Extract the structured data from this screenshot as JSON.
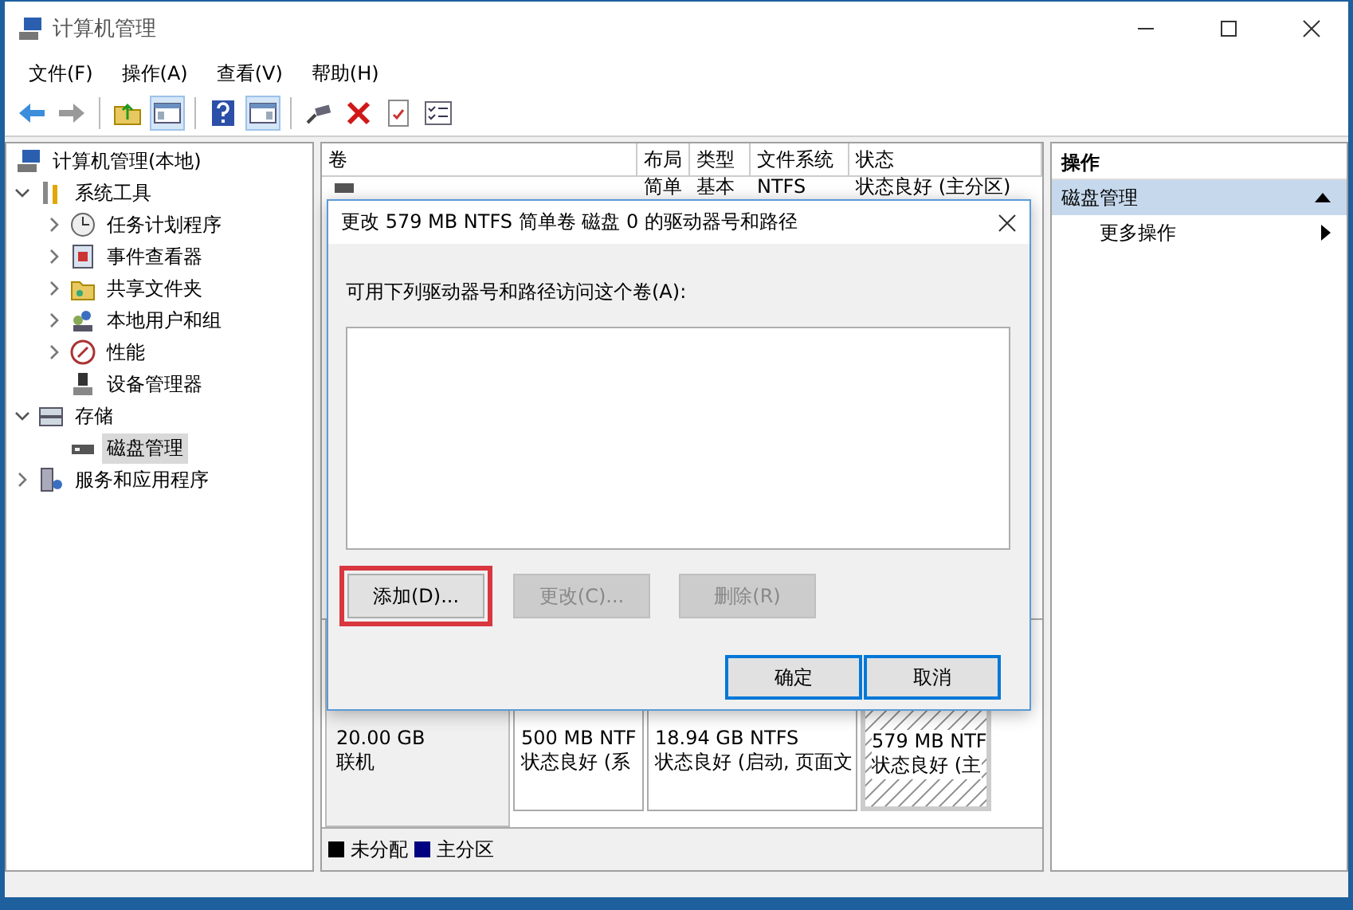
{
  "window": {
    "title": "计算机管理"
  },
  "menu": [
    "文件(F)",
    "操作(A)",
    "查看(V)",
    "帮助(H)"
  ],
  "toolbar": [
    {
      "kind": "back",
      "disabled": false
    },
    {
      "kind": "forward",
      "disabled": true
    },
    {
      "kind": "separator"
    },
    {
      "kind": "folder_up",
      "disabled": false
    },
    {
      "kind": "tree_toggle",
      "on": true
    },
    {
      "kind": "separator"
    },
    {
      "kind": "help",
      "disabled": false
    },
    {
      "kind": "pane_toggle",
      "on": true
    },
    {
      "kind": "separator"
    },
    {
      "kind": "connect"
    },
    {
      "kind": "delete",
      "disabled": false
    },
    {
      "kind": "properties"
    },
    {
      "kind": "checklist"
    }
  ],
  "tree": {
    "items": [
      {
        "label": "计算机管理(本地)",
        "kind": "computer",
        "selected": false,
        "children": [
          {
            "label": "系统工具",
            "kind": "tools",
            "expanded": true,
            "selected": false,
            "children": [
              {
                "label": "任务计划程序",
                "kind": "clock",
                "expanded": false,
                "selected": false
              },
              {
                "label": "事件查看器",
                "kind": "event",
                "expanded": false,
                "selected": false
              },
              {
                "label": "共享文件夹",
                "kind": "share",
                "expanded": false,
                "selected": false
              },
              {
                "label": "本地用户和组",
                "kind": "users",
                "expanded": false,
                "selected": false
              },
              {
                "label": "性能",
                "kind": "perf",
                "expanded": false,
                "selected": false
              },
              {
                "label": "设备管理器",
                "kind": "device",
                "selected": false
              }
            ]
          },
          {
            "label": "存储",
            "kind": "storage",
            "expanded": true,
            "selected": false,
            "children": [
              {
                "label": "磁盘管理",
                "kind": "disk",
                "selected": true
              }
            ]
          },
          {
            "label": "服务和应用程序",
            "kind": "services",
            "expanded": false,
            "selected": false
          }
        ]
      }
    ]
  },
  "volumes": {
    "columns": [
      "卷",
      "布局",
      "类型",
      "文件系统",
      "状态"
    ],
    "rows": [
      {
        "layout": "简单",
        "type": "基本",
        "file_system": "NTFS",
        "status": "状态良好 (主分区)"
      }
    ]
  },
  "disk_map": {
    "disk": {
      "size": "20.00 GB",
      "status": "联机"
    },
    "partitions": [
      {
        "size": "500 MB NTF",
        "status": "状态良好 (系",
        "selected": false
      },
      {
        "size": "18.94 GB NTFS",
        "status": "状态良好 (启动, 页面文",
        "selected": false
      },
      {
        "size": "579 MB NTF",
        "status": "状态良好 (主",
        "selected": true
      }
    ],
    "legend": [
      {
        "label": "未分配",
        "color": "#000000"
      },
      {
        "label": "主分区",
        "color": "#000080"
      }
    ]
  },
  "actions": {
    "header": "操作",
    "items": [
      {
        "label": "磁盘管理",
        "kind": "section",
        "selected": true
      },
      {
        "label": "更多操作",
        "kind": "submenu",
        "selected": false
      }
    ]
  },
  "dialog": {
    "title": "更改 579 MB NTFS 简单卷 磁盘 0 的驱动器号和路径",
    "prompt": "可用下列驱动器号和路径访问这个卷(A):",
    "buttons": [
      {
        "label": "添加(D)...",
        "disabled": false,
        "highlighted": true
      },
      {
        "label": "更改(C)...",
        "disabled": true,
        "highlighted": false
      },
      {
        "label": "删除(R)",
        "disabled": true,
        "highlighted": false
      }
    ],
    "footer_buttons": [
      "确定",
      "取消"
    ]
  }
}
